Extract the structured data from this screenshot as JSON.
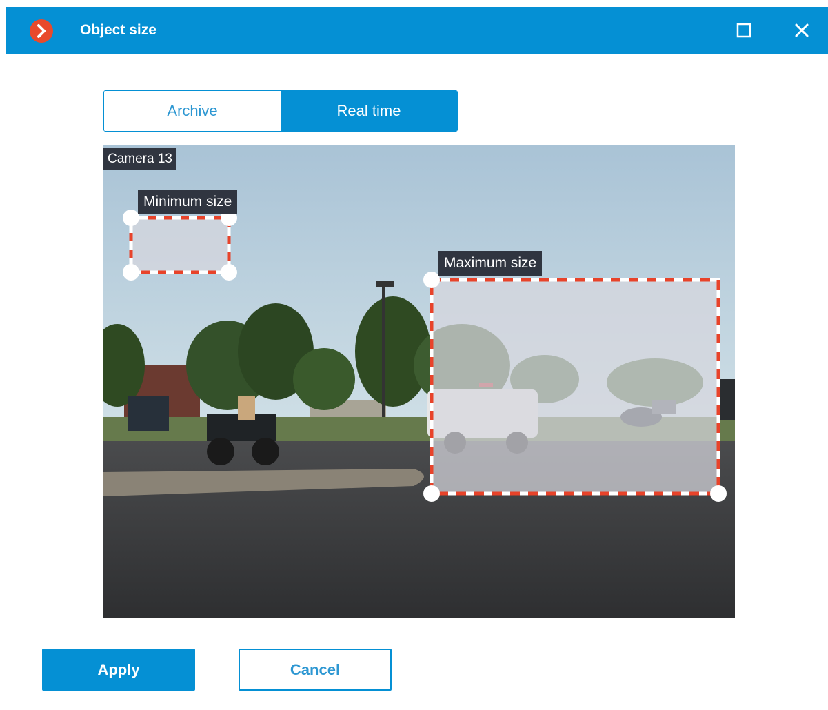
{
  "window": {
    "title": "Object size",
    "icons": {
      "logo": "app-logo-icon",
      "maximize": "maximize-icon",
      "close": "close-icon"
    }
  },
  "tabs": {
    "items": [
      {
        "label": "Archive",
        "active": false
      },
      {
        "label": "Real time",
        "active": true
      }
    ]
  },
  "video": {
    "camera_label": "Camera 13",
    "zones": {
      "minimum": {
        "label": "Minimum size"
      },
      "maximum": {
        "label": "Maximum size"
      }
    }
  },
  "footer": {
    "apply_label": "Apply",
    "cancel_label": "Cancel"
  },
  "colors": {
    "accent": "#0590d4",
    "logo": "#e84a2c",
    "zone_border_red": "#e8432a",
    "label_bg": "#303540"
  }
}
